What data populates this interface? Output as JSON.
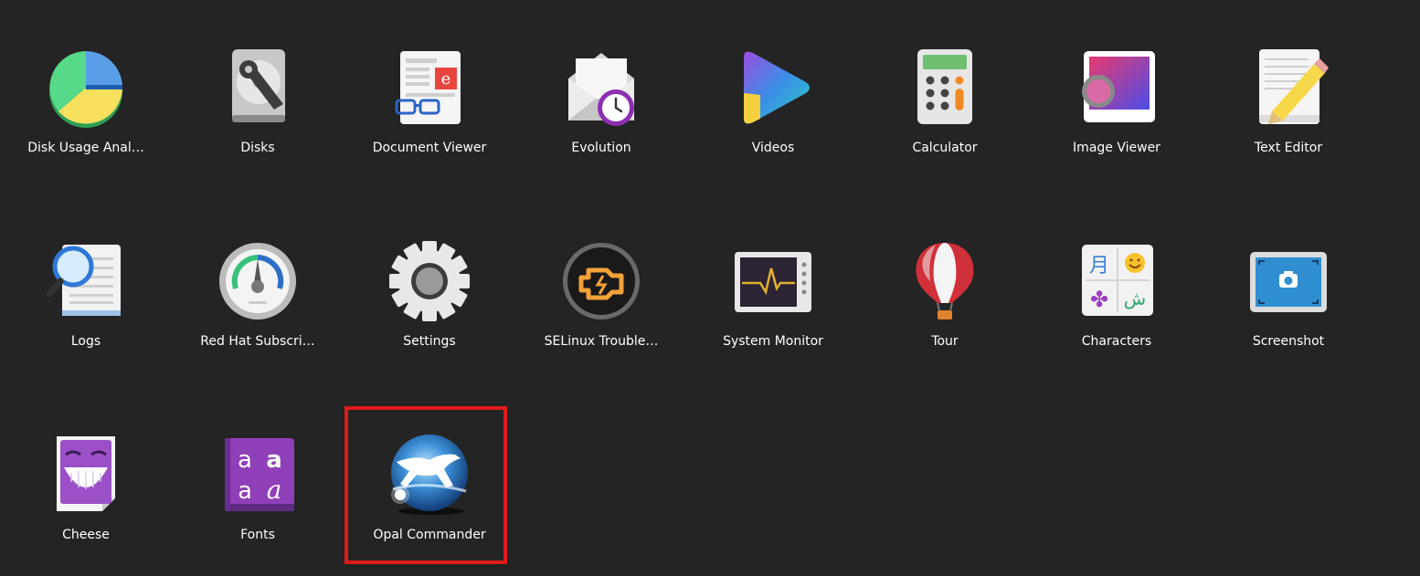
{
  "colors": {
    "background": "#242424",
    "label_text": "#ffffff",
    "highlight_border": "#e01b1b"
  },
  "apps": [
    {
      "label": "Disk Usage Anal…",
      "icon": "disk-usage-analyzer-icon"
    },
    {
      "label": "Disks",
      "icon": "disks-icon"
    },
    {
      "label": "Document Viewer",
      "icon": "document-viewer-icon"
    },
    {
      "label": "Evolution",
      "icon": "evolution-icon"
    },
    {
      "label": "Videos",
      "icon": "videos-icon"
    },
    {
      "label": "Calculator",
      "icon": "calculator-icon"
    },
    {
      "label": "Image Viewer",
      "icon": "image-viewer-icon"
    },
    {
      "label": "Text Editor",
      "icon": "text-editor-icon"
    },
    {
      "label": "Logs",
      "icon": "logs-icon"
    },
    {
      "label": "Red Hat Subscri…",
      "icon": "subscription-manager-icon"
    },
    {
      "label": "Settings",
      "icon": "settings-icon"
    },
    {
      "label": "SELinux Trouble…",
      "icon": "selinux-troubleshooter-icon"
    },
    {
      "label": "System Monitor",
      "icon": "system-monitor-icon"
    },
    {
      "label": "Tour",
      "icon": "tour-icon"
    },
    {
      "label": "Characters",
      "icon": "characters-icon"
    },
    {
      "label": "Screenshot",
      "icon": "screenshot-icon"
    },
    {
      "label": "Cheese",
      "icon": "cheese-icon"
    },
    {
      "label": "Fonts",
      "icon": "fonts-icon"
    },
    {
      "label": "Opal Commander",
      "icon": "opal-commander-icon"
    }
  ],
  "highlighted_app": "Opal Commander"
}
